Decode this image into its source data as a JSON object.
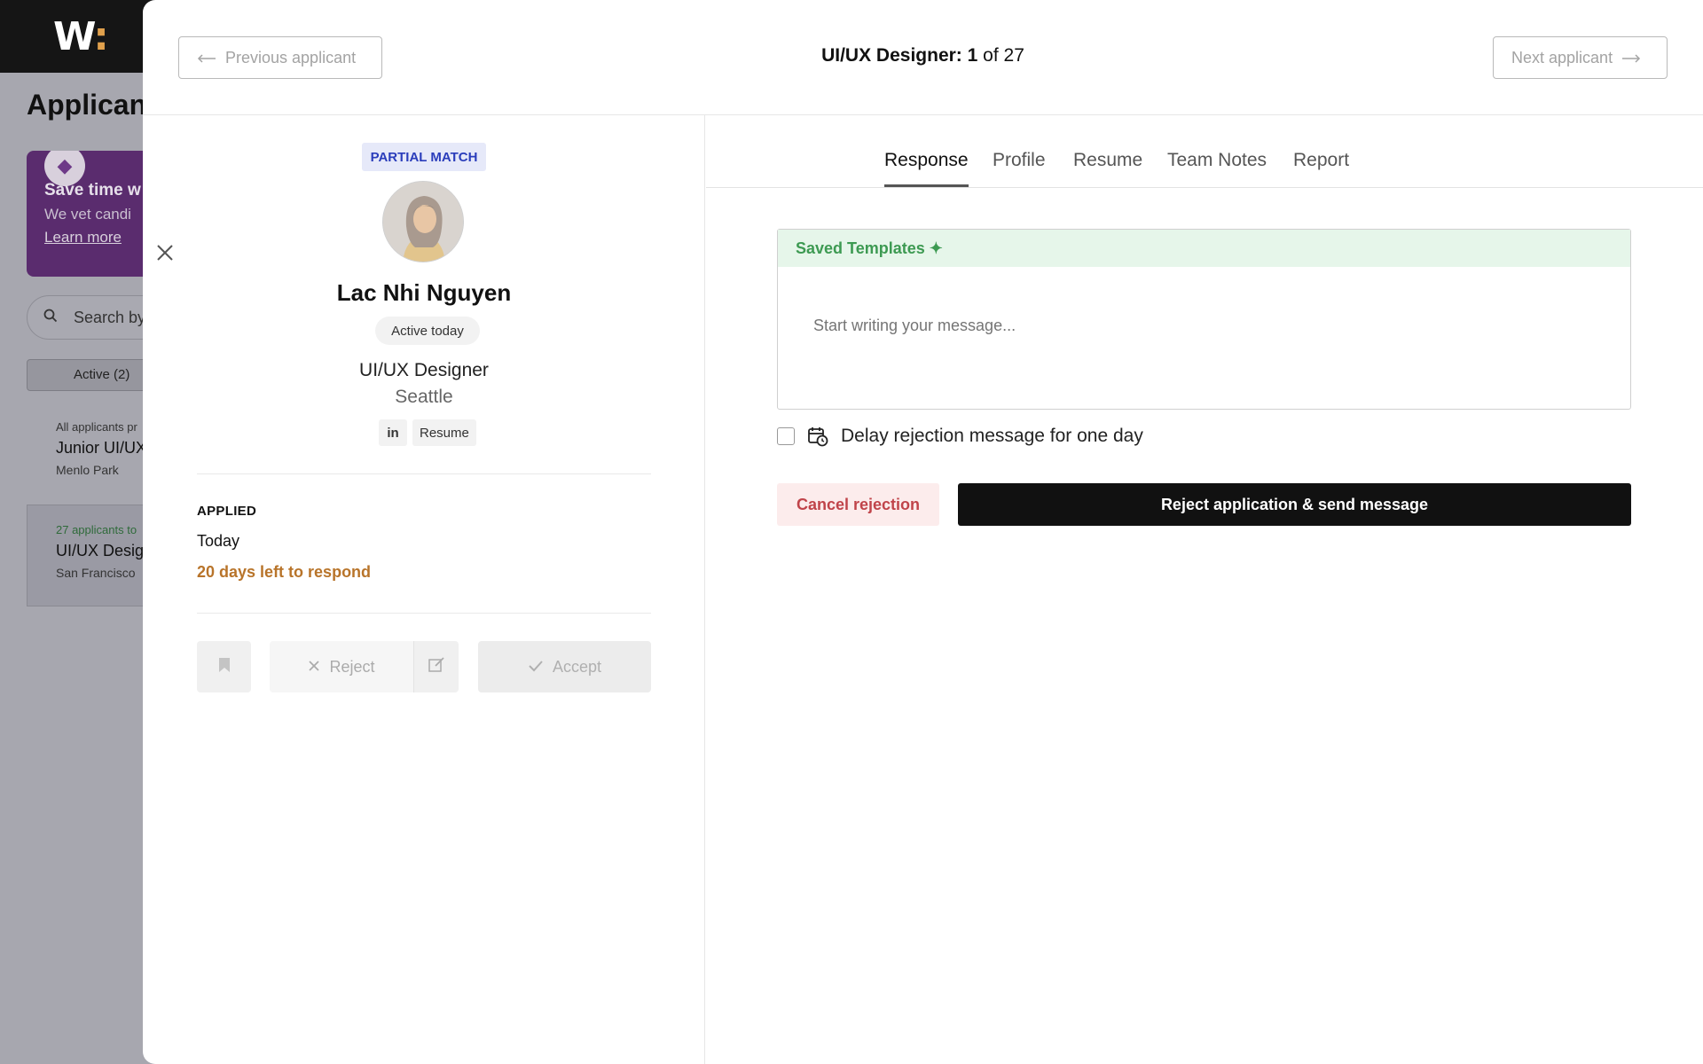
{
  "background": {
    "logo": "W",
    "logo_dots": ":",
    "page_title": "Applican",
    "promo": {
      "title": "Save time w",
      "text": "We vet candi",
      "link": "Learn more"
    },
    "search_placeholder": "Search by",
    "filter_chip": "Active (2)",
    "jobs": [
      {
        "meta": "All applicants pr",
        "title": "Junior UI/UX",
        "location": "Menlo Park"
      },
      {
        "meta": "27 applicants to",
        "title": "UI/UX Desig",
        "location": "San Francisco"
      }
    ]
  },
  "header": {
    "prev_label": "Previous applicant",
    "next_label": "Next applicant",
    "title_role": "UI/UX Designer:",
    "title_index": "1",
    "title_of": "of 27"
  },
  "candidate": {
    "match_badge": "PARTIAL MATCH",
    "name": "Lac Nhi Nguyen",
    "activity": "Active today",
    "role": "UI/UX Designer",
    "city": "Seattle",
    "linkedin_label": "in",
    "resume_label": "Resume",
    "applied_label": "APPLIED",
    "applied_value": "Today",
    "days_left": "20 days left to respond",
    "reject_label": "Reject",
    "accept_label": "Accept"
  },
  "tabs": [
    "Response",
    "Profile",
    "Resume",
    "Team Notes",
    "Report"
  ],
  "active_tab": "Response",
  "response": {
    "templates_label": "Saved Templates ✦",
    "message_placeholder": "Start writing your message...",
    "delay_label": "Delay rejection message for one day",
    "cancel_label": "Cancel rejection",
    "send_label": "Reject application & send message"
  },
  "colors": {
    "match_badge_bg": "#e6e9f9",
    "match_badge_text": "#2a3dbb",
    "days_left": "#b8742a",
    "templates_green": "#3d9a52",
    "cancel_red": "#c0444a",
    "primary_black": "#111111"
  }
}
